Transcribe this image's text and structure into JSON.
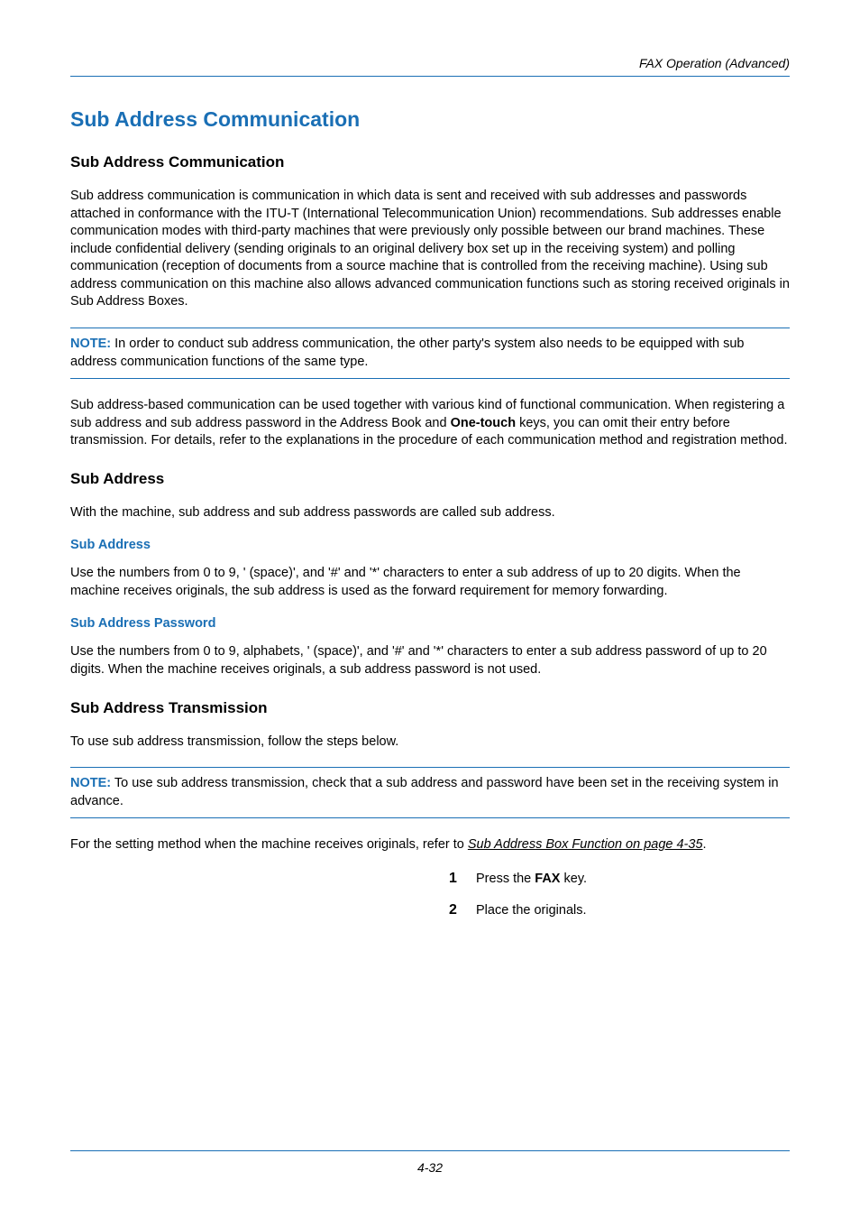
{
  "running_head": "FAX Operation (Advanced)",
  "h1": "Sub Address Communication",
  "sec1": {
    "h2": "Sub Address Communication",
    "para": "Sub address communication is communication in which data is sent and received with sub addresses and passwords attached in conformance with the ITU-T (International Telecommunication Union) recommendations. Sub addresses enable communication modes with third-party machines that were previously only possible between our brand machines. These include confidential delivery (sending originals to an original delivery box set up in the receiving system) and polling communication (reception of documents from a source machine that is controlled from the receiving machine). Using sub address communication on this machine also allows advanced communication functions such as storing received originals in Sub Address Boxes.",
    "note_label": "NOTE:",
    "note": " In order to conduct sub address communication, the other party's system also needs to be equipped with sub address communication functions of the same type.",
    "para2_a": "Sub address-based communication can be used together with various kind of functional communication. When registering a sub address and sub address password in the Address Book and ",
    "para2_b": "One-touch",
    "para2_c": " keys, you can omit their entry before transmission. For details, refer to the explanations in the procedure of each communication method and registration method."
  },
  "sec2": {
    "h2": "Sub Address",
    "para": "With the machine, sub address and sub address passwords are called sub address.",
    "sub1_h3": "Sub Address",
    "sub1_para": "Use the numbers from 0 to 9, ' (space)', and '#' and '*' characters to enter a sub address of up to 20 digits. When the machine receives originals, the sub address is used as the forward requirement for memory forwarding.",
    "sub2_h3": "Sub Address Password",
    "sub2_para": "Use the numbers from 0 to 9, alphabets, ' (space)', and '#' and '*' characters to enter a sub address password of up to 20 digits. When the machine receives originals, a sub address password is not used."
  },
  "sec3": {
    "h2": "Sub Address Transmission",
    "para": "To use sub address transmission, follow the steps below.",
    "note_label": "NOTE:",
    "note": " To use sub address transmission, check that a sub address and password have been set in the receiving system in advance.",
    "para2_a": "For the setting method when the machine receives originals, refer to ",
    "para2_link": "Sub Address Box Function on page 4-35",
    "para2_c": ".",
    "steps": [
      {
        "num": "1",
        "pre": "Press the ",
        "bold": "FAX",
        "post": " key."
      },
      {
        "num": "2",
        "pre": "Place the originals.",
        "bold": "",
        "post": ""
      }
    ]
  },
  "footer": "4-32"
}
